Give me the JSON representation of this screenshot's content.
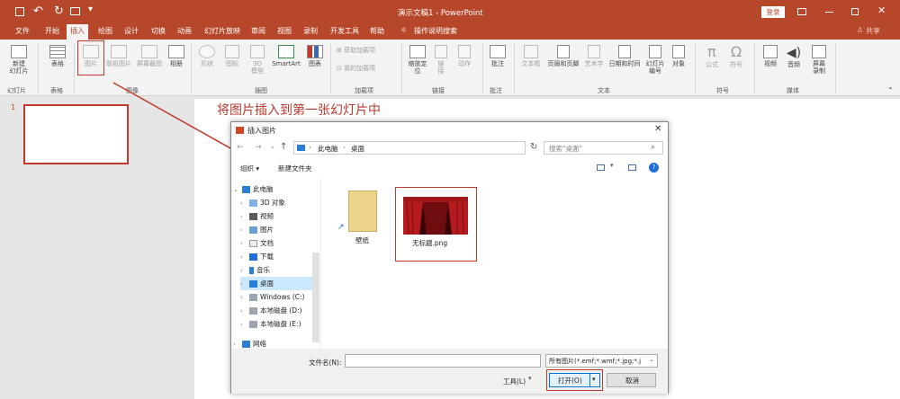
{
  "titlebar": {
    "title": "演示文稿1 - PowerPoint",
    "login": "登录"
  },
  "menu": [
    "文件",
    "开始",
    "插入",
    "绘图",
    "设计",
    "切换",
    "动画",
    "幻灯片放映",
    "审阅",
    "视图",
    "录制",
    "开发工具",
    "帮助"
  ],
  "menu_active": "插入",
  "menu_search": "操作说明搜索",
  "share": "共享",
  "ribbon": {
    "new_slide": "新建\n幻灯片",
    "table": "表格",
    "picture": "图片",
    "screen_capture": "联机图片",
    "screenshot": "屏幕截图",
    "album": "相册",
    "shapes": "形状",
    "icons": "图标",
    "models": "3D\n模型",
    "smartart": "SmartArt",
    "chart": "图表",
    "get_addins": "获取加载项",
    "my_addins": "我的加载项",
    "zoom": "缩放定\n位",
    "link": "链\n接",
    "action": "动作",
    "comment": "批注",
    "textbox": "文本框",
    "header_footer": "页眉和页脚",
    "wordart": "艺术字",
    "datetime": "日期和时间",
    "slide_number": "幻灯片\n编号",
    "object": "对象",
    "equation": "公式",
    "symbol": "符号",
    "video": "视频",
    "audio": "音频",
    "screen_record": "屏幕\n录制",
    "groups": {
      "slides": "幻灯片",
      "tables": "表格",
      "images": "图像",
      "illustrations": "插图",
      "addins": "加载项",
      "links": "链接",
      "comments": "批注",
      "text": "文本",
      "symbols": "符号",
      "media": "媒体"
    }
  },
  "slide_number": "1",
  "instruction": "将图片插入到第一张幻灯片中",
  "dialog": {
    "title": "插入图片",
    "path": [
      "此电脑",
      "桌面"
    ],
    "search_placeholder": "搜索\"桌面\"",
    "organize": "组织 ▾",
    "new_folder": "新建文件夹",
    "nav": [
      {
        "label": "此电脑",
        "icon": "computer"
      },
      {
        "label": "3D 对象",
        "icon": "3d"
      },
      {
        "label": "视频",
        "icon": "video"
      },
      {
        "label": "图片",
        "icon": "pictures"
      },
      {
        "label": "文档",
        "icon": "documents"
      },
      {
        "label": "下载",
        "icon": "downloads"
      },
      {
        "label": "音乐",
        "icon": "music"
      },
      {
        "label": "桌面",
        "icon": "desktop"
      },
      {
        "label": "Windows (C:)",
        "icon": "drive"
      },
      {
        "label": "本地磁盘 (D:)",
        "icon": "drive"
      },
      {
        "label": "本地磁盘 (E:)",
        "icon": "drive"
      },
      {
        "label": "网络",
        "icon": "network"
      }
    ],
    "files": [
      {
        "name": "壁纸",
        "type": "folder"
      },
      {
        "name": "无标题.png",
        "type": "image"
      }
    ],
    "filename_label": "文件名(N):",
    "filename_value": "",
    "filetype": "所有图片(*.emf;*.wmf;*.jpg;*.j",
    "tools": "工具(L)",
    "open": "打开(O)",
    "cancel": "取消"
  },
  "colors": {
    "accent": "#b7472a",
    "annotation": "#c0392b",
    "selected": "#cce8ff"
  }
}
